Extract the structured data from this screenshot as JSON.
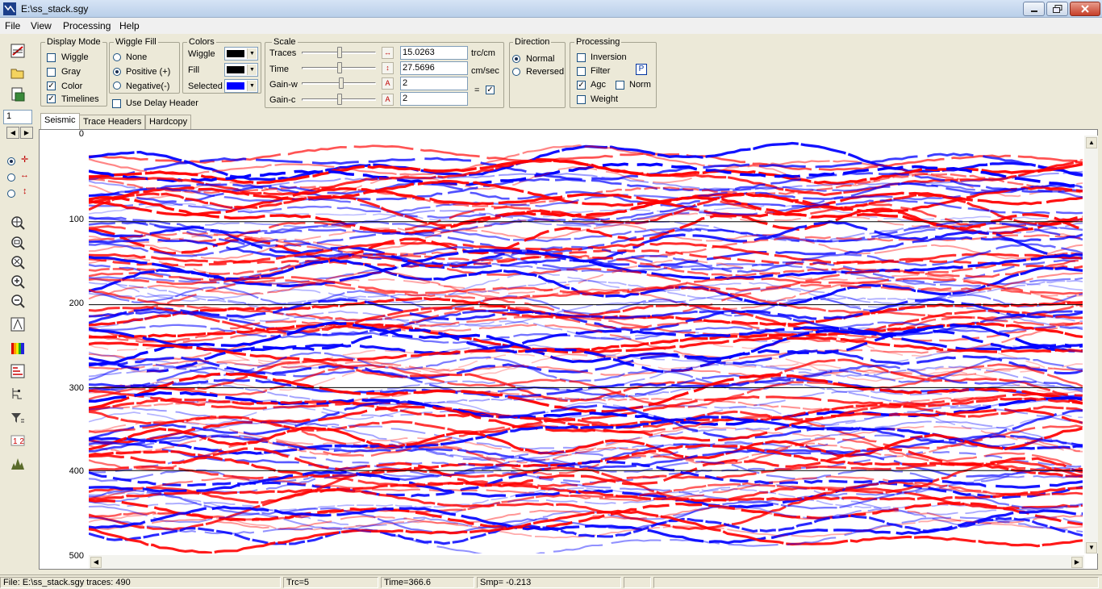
{
  "window": {
    "title": "E:\\ss_stack.sgy"
  },
  "menu": [
    "File",
    "View",
    "Processing",
    "Help"
  ],
  "display_mode": {
    "title": "Display Mode",
    "items": [
      {
        "label": "Wiggle",
        "checked": false
      },
      {
        "label": "Gray",
        "checked": false
      },
      {
        "label": "Color",
        "checked": true
      },
      {
        "label": "Timelines",
        "checked": true
      }
    ]
  },
  "wiggle_fill": {
    "title": "Wiggle Fill",
    "items": [
      {
        "label": "None",
        "selected": false
      },
      {
        "label": "Positive (+)",
        "selected": true
      },
      {
        "label": "Negative(-)",
        "selected": false
      }
    ],
    "use_delay_header": {
      "label": "Use Delay  Header",
      "checked": false
    }
  },
  "colors": {
    "title": "Colors",
    "wiggle": {
      "label": "Wiggle",
      "color": "#000000"
    },
    "fill": {
      "label": "Fill",
      "color": "#000000"
    },
    "selected": {
      "label": "Selected",
      "color": "#0000ff"
    }
  },
  "scale": {
    "title": "Scale",
    "traces": {
      "label": "Traces",
      "value": "15.0263",
      "unit": "trc/cm"
    },
    "time": {
      "label": "Time",
      "value": "27.5696",
      "unit": "cm/sec"
    },
    "gain_w": {
      "label": "Gain-w",
      "value": "2"
    },
    "gain_c": {
      "label": "Gain-c",
      "value": "2"
    },
    "equal_sign": "=",
    "link_checked": true
  },
  "direction": {
    "title": "Direction",
    "items": [
      {
        "label": "Normal",
        "selected": true
      },
      {
        "label": "Reversed",
        "selected": false
      }
    ]
  },
  "processing": {
    "title": "Processing",
    "inversion": {
      "label": "Inversion",
      "checked": false
    },
    "filter": {
      "label": "Filter",
      "checked": false
    },
    "agc": {
      "label": "Agc",
      "checked": true
    },
    "norm": {
      "label": "Norm",
      "checked": false
    },
    "weight": {
      "label": "Weight",
      "checked": false
    },
    "p_button": "P"
  },
  "page_field": "1",
  "tabs": [
    "Seismic",
    "Trace Headers",
    "Hardcopy"
  ],
  "active_tab": "Seismic",
  "plot": {
    "y_ticks": [
      "0",
      "100",
      "200",
      "300",
      "400",
      "500"
    ],
    "timeline_color": "#000000",
    "positive_color": "#ff0000",
    "negative_color": "#0000ff"
  },
  "status": {
    "file": "File: E:\\ss_stack.sgy traces: 490",
    "trc": "Trc=5",
    "time": "Time=366.6",
    "smp": "Smp=     -0.213"
  }
}
